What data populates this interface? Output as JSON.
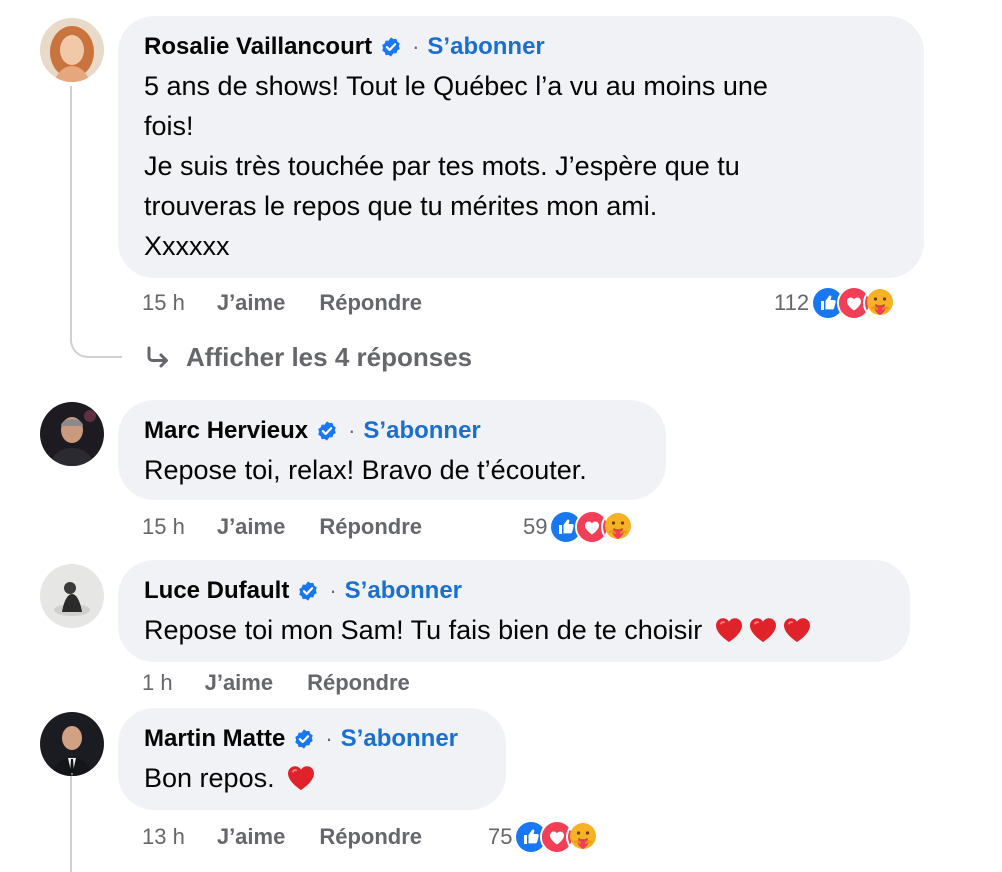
{
  "comments": [
    {
      "author": "Rosalie Vaillancourt",
      "follow_label": "S’abonner",
      "separator": "·",
      "text_lines": [
        "5 ans de shows! Tout le Québec l’a vu au moins une",
        "fois!",
        "Je suis très touchée par tes mots. J’espère que tu",
        "trouveras le repos que tu mérites mon ami.",
        "Xxxxxx"
      ],
      "time": "15 h",
      "like_label": "J’aime",
      "reply_label": "Répondre",
      "reaction_count": "112",
      "reactions": [
        "like-icon",
        "love-icon",
        "care-icon"
      ],
      "view_replies_label": "Afficher les 4 réponses"
    },
    {
      "author": "Marc Hervieux",
      "follow_label": "S’abonner",
      "separator": "·",
      "text": "Repose toi, relax! Bravo de t’écouter.",
      "time": "15 h",
      "like_label": "J’aime",
      "reply_label": "Répondre",
      "reaction_count": "59",
      "reactions": [
        "like-icon",
        "love-icon",
        "care-icon"
      ]
    },
    {
      "author": "Luce Dufault",
      "follow_label": "S’abonner",
      "separator": "·",
      "text": "Repose toi mon Sam! Tu fais bien de te choisir",
      "emoji": [
        "red-heart-emoji",
        "red-heart-emoji",
        "red-heart-emoji"
      ],
      "time": "1 h",
      "like_label": "J’aime",
      "reply_label": "Répondre"
    },
    {
      "author": "Martin Matte",
      "follow_label": "S’abonner",
      "separator": "·",
      "text": "Bon repos.",
      "emoji": [
        "red-heart-emoji"
      ],
      "time": "13 h",
      "like_label": "J’aime",
      "reply_label": "Répondre",
      "reaction_count": "75",
      "reactions": [
        "like-icon",
        "love-icon",
        "care-icon"
      ]
    }
  ],
  "colors": {
    "link_blue": "#1a6fd1",
    "bubble_bg": "#f0f2f5",
    "meta_gray": "#65676b",
    "like_blue": "#1877f2",
    "love_red": "#f33e58"
  }
}
